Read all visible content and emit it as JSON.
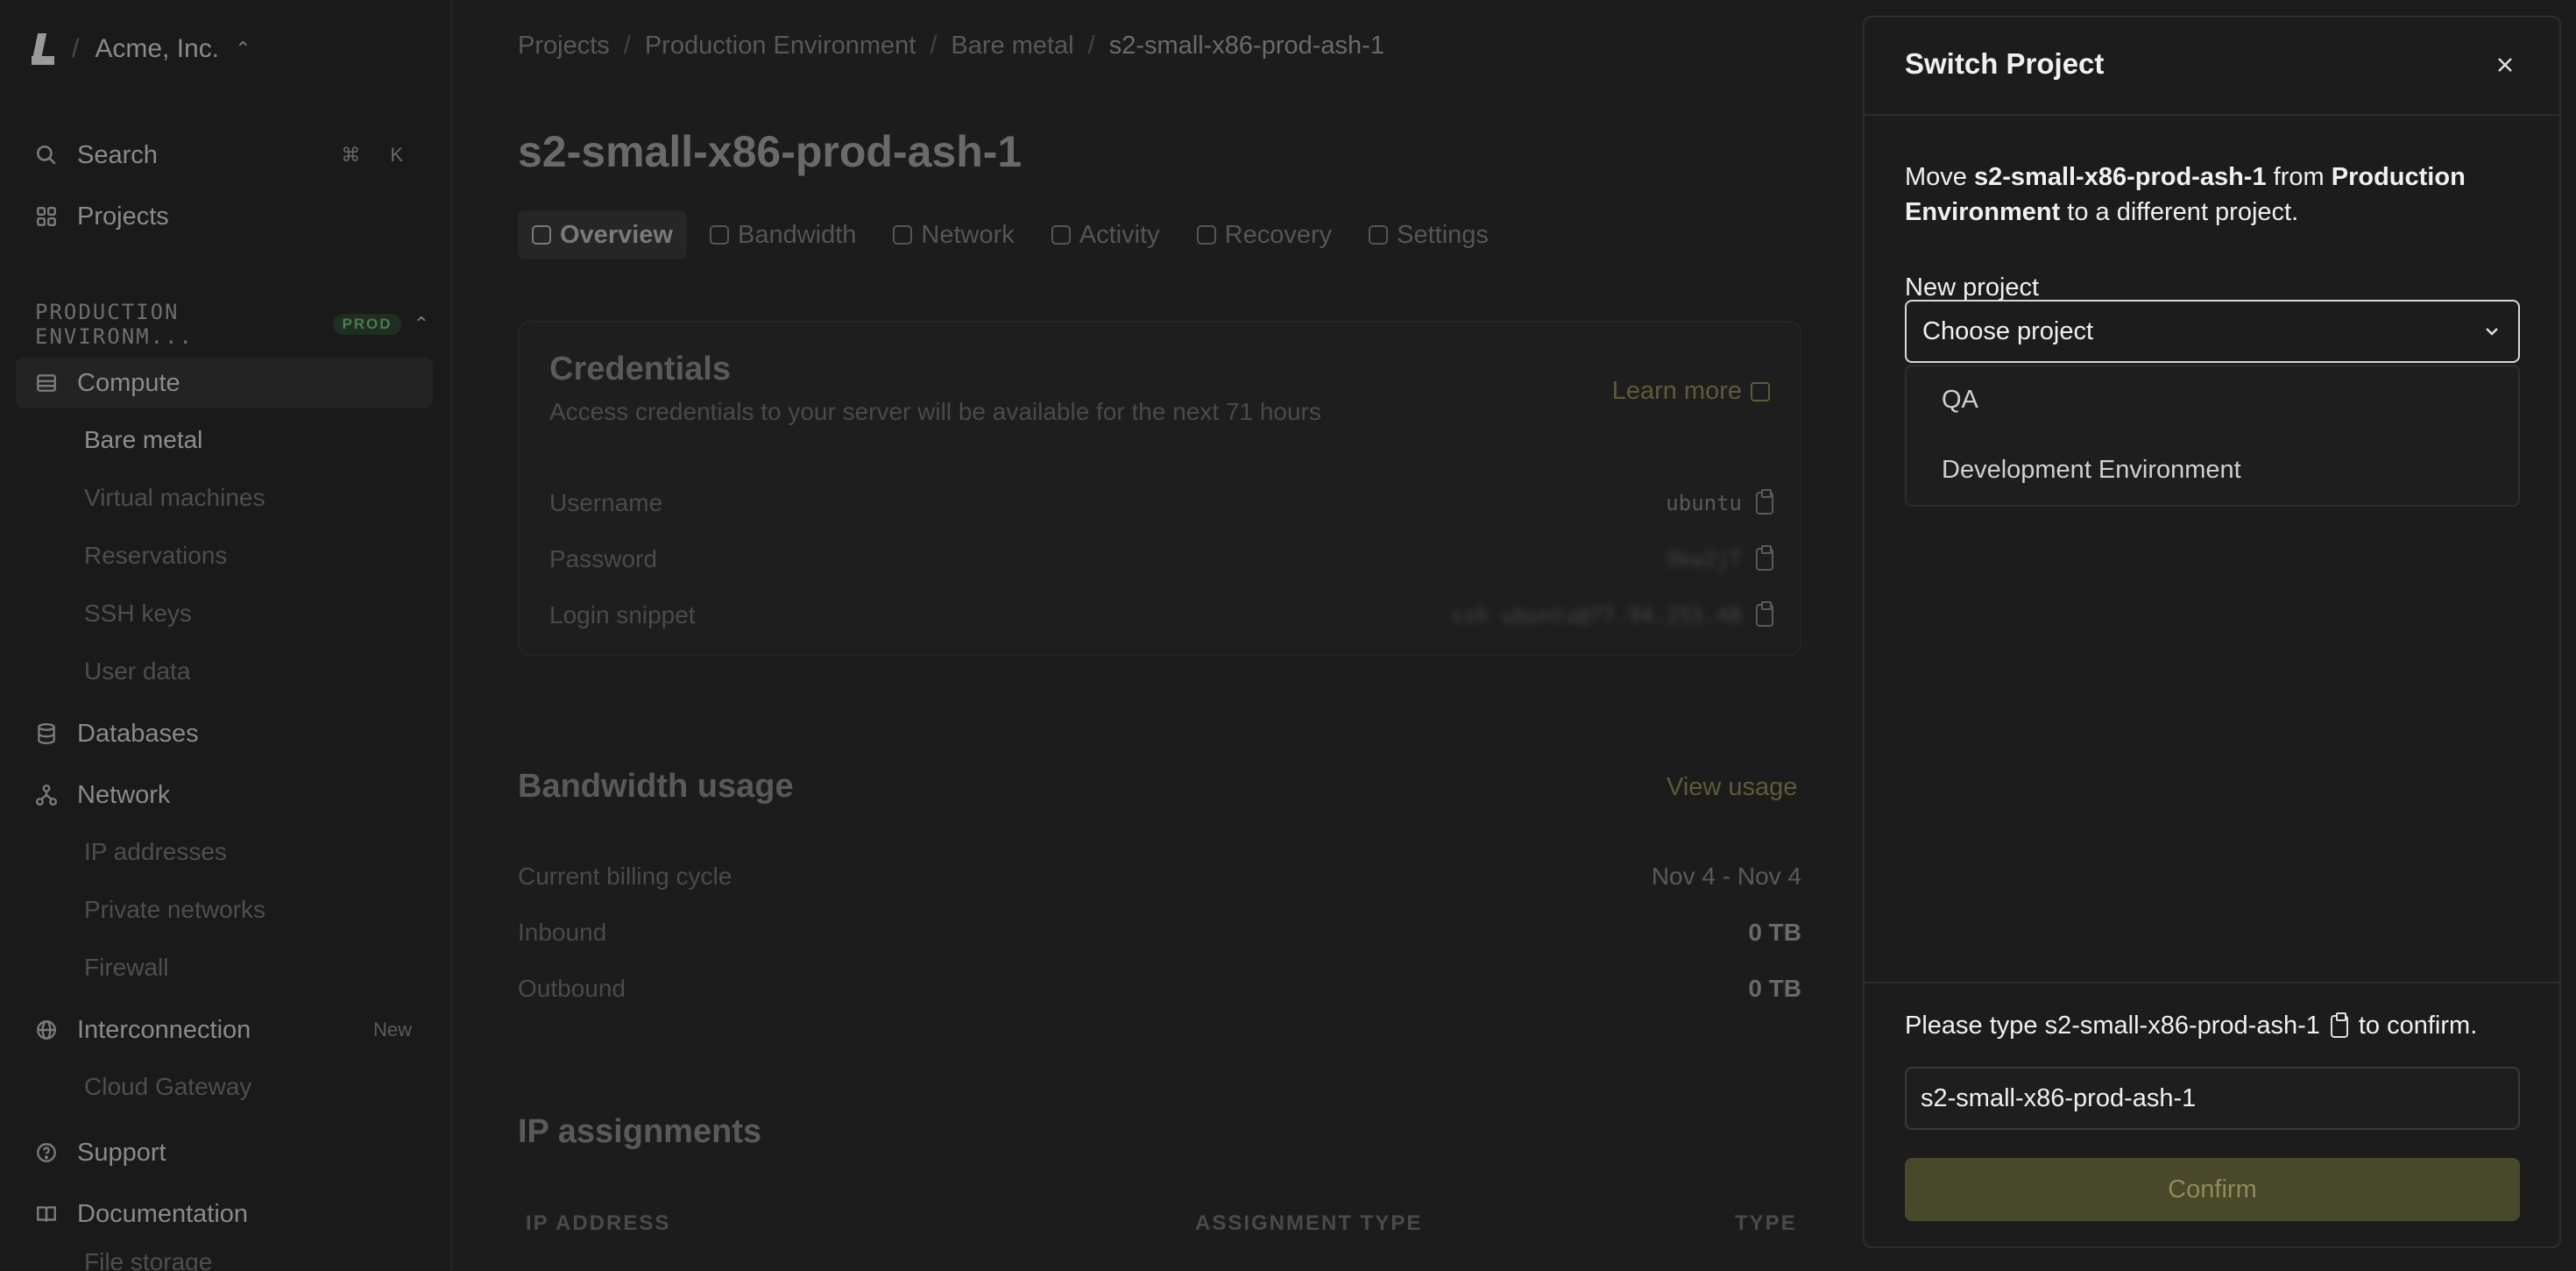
{
  "sidebar": {
    "org": "Acme, Inc.",
    "search_label": "Search",
    "search_shortcut": "⌘ K",
    "projects_label": "Projects",
    "section_title": "PRODUCTION ENVIRONM...",
    "section_badge": "PROD",
    "compute_label": "Compute",
    "compute_items": [
      "Bare metal",
      "Virtual machines",
      "Reservations",
      "SSH keys",
      "User data"
    ],
    "databases_label": "Databases",
    "network_label": "Network",
    "network_items": [
      "IP addresses",
      "Private networks",
      "Firewall"
    ],
    "interconnection_label": "Interconnection",
    "interconnection_badge": "New",
    "interconnection_items": [
      "Cloud Gateway"
    ],
    "support_label": "Support",
    "documentation_label": "Documentation",
    "documentation_items": [
      "File storage"
    ]
  },
  "breadcrumb": [
    "Projects",
    "Production Environment",
    "Bare metal",
    "s2-small-x86-prod-ash-1"
  ],
  "page_title": "s2-small-x86-prod-ash-1",
  "tabs": [
    "Overview",
    "Bandwidth",
    "Network",
    "Activity",
    "Recovery",
    "Settings"
  ],
  "credentials": {
    "title": "Credentials",
    "description": "Access credentials to your server will be available for the next 71 hours",
    "learn_more": "Learn more",
    "rows": [
      {
        "label": "Username",
        "value": "ubuntu"
      },
      {
        "label": "Password",
        "value": "9kw2jT"
      },
      {
        "label": "Login snippet",
        "value": "ssh ubuntu@77.94.255.48"
      }
    ]
  },
  "bandwidth": {
    "title": "Bandwidth usage",
    "view_usage": "View usage",
    "rows": [
      {
        "label": "Current billing cycle",
        "value": "Nov 4 - Nov 4"
      },
      {
        "label": "Inbound",
        "value": "0 TB"
      },
      {
        "label": "Outbound",
        "value": "0 TB"
      }
    ]
  },
  "ip_assignments": {
    "title": "IP assignments",
    "headers": [
      "IP ADDRESS",
      "ASSIGNMENT TYPE",
      "TYPE"
    ]
  },
  "dialog": {
    "title": "Switch Project",
    "body_move": "Move ",
    "body_server": "s2-small-x86-prod-ash-1",
    "body_from": " from ",
    "body_project": "Production Environment",
    "body_tail": " to a different project.",
    "new_project_label": "New project",
    "select_value": "Choose project",
    "options": [
      "QA",
      "Development Environment"
    ],
    "confirm_prefix": "Please type s2-small-x86-prod-ash-1",
    "confirm_suffix": "to confirm.",
    "input_value": "s2-small-x86-prod-ash-1",
    "confirm_button": "Confirm"
  },
  "colors": {
    "background": "#1c1c1c",
    "confirm_button": "#48482a",
    "accent_muted": "#5e5a3a"
  }
}
